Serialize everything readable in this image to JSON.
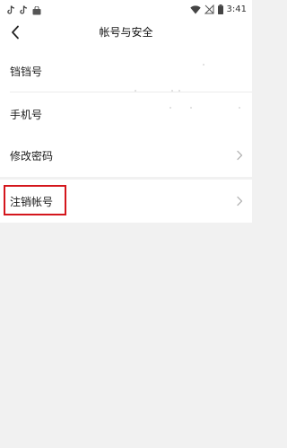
{
  "status_bar": {
    "time": "3:41"
  },
  "nav": {
    "title": "帐号与安全"
  },
  "account_section": {
    "items": [
      {
        "label": "铛铛号"
      },
      {
        "label": "手机号"
      }
    ]
  },
  "password_section": {
    "label": "修改密码"
  },
  "cancel_section": {
    "label": "注销帐号"
  },
  "colors": {
    "background": "#f1f1f1",
    "card": "#ffffff",
    "highlight": "#d4161c",
    "chevron": "#b5b5b5"
  }
}
